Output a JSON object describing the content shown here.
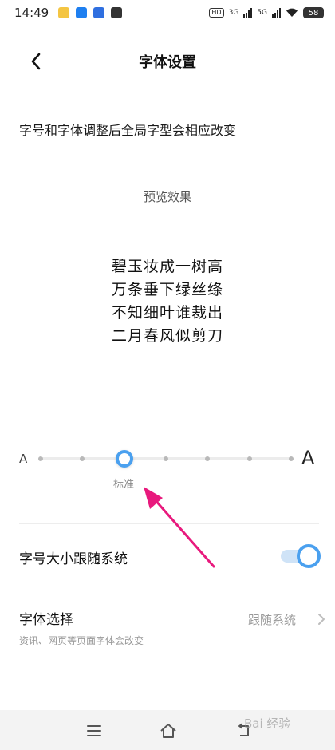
{
  "status_bar": {
    "time": "14:49",
    "network_hd": "HD",
    "network_1": "3G",
    "network_2": "5G",
    "battery": "58"
  },
  "header": {
    "title": "字体设置"
  },
  "description": "字号和字体调整后全局字型会相应改变",
  "preview": {
    "label": "预览效果",
    "lines": [
      "碧玉妆成一树高",
      "万条垂下绿丝绦",
      "不知细叶谁裁出",
      "二月春风似剪刀"
    ]
  },
  "font_size_slider": {
    "small_label": "A",
    "large_label": "A",
    "caption": "标准",
    "selected_step": 2,
    "step_count": 7
  },
  "follow_system": {
    "label": "字号大小跟随系统",
    "enabled": true
  },
  "font_choice": {
    "label": "字体选择",
    "subtitle": "资讯、网页等页面字体会改变",
    "value": "跟随系统"
  },
  "watermark": "Bai 经验",
  "colors": {
    "accent": "#4aa0ef",
    "annotation_arrow": "#e8197d"
  }
}
